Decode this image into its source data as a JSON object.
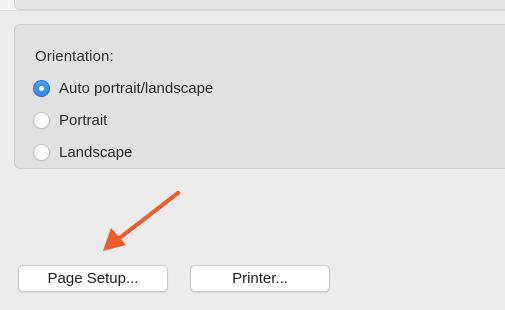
{
  "orientation": {
    "title": "Orientation:",
    "options": [
      {
        "label": "Auto portrait/landscape",
        "selected": true
      },
      {
        "label": "Portrait",
        "selected": false
      },
      {
        "label": "Landscape",
        "selected": false
      }
    ]
  },
  "buttons": {
    "page_setup_label": "Page Setup...",
    "printer_label": "Printer..."
  },
  "colors": {
    "accent": "#2f83ee",
    "arrow": "#f15a2b",
    "background": "#ececec"
  }
}
